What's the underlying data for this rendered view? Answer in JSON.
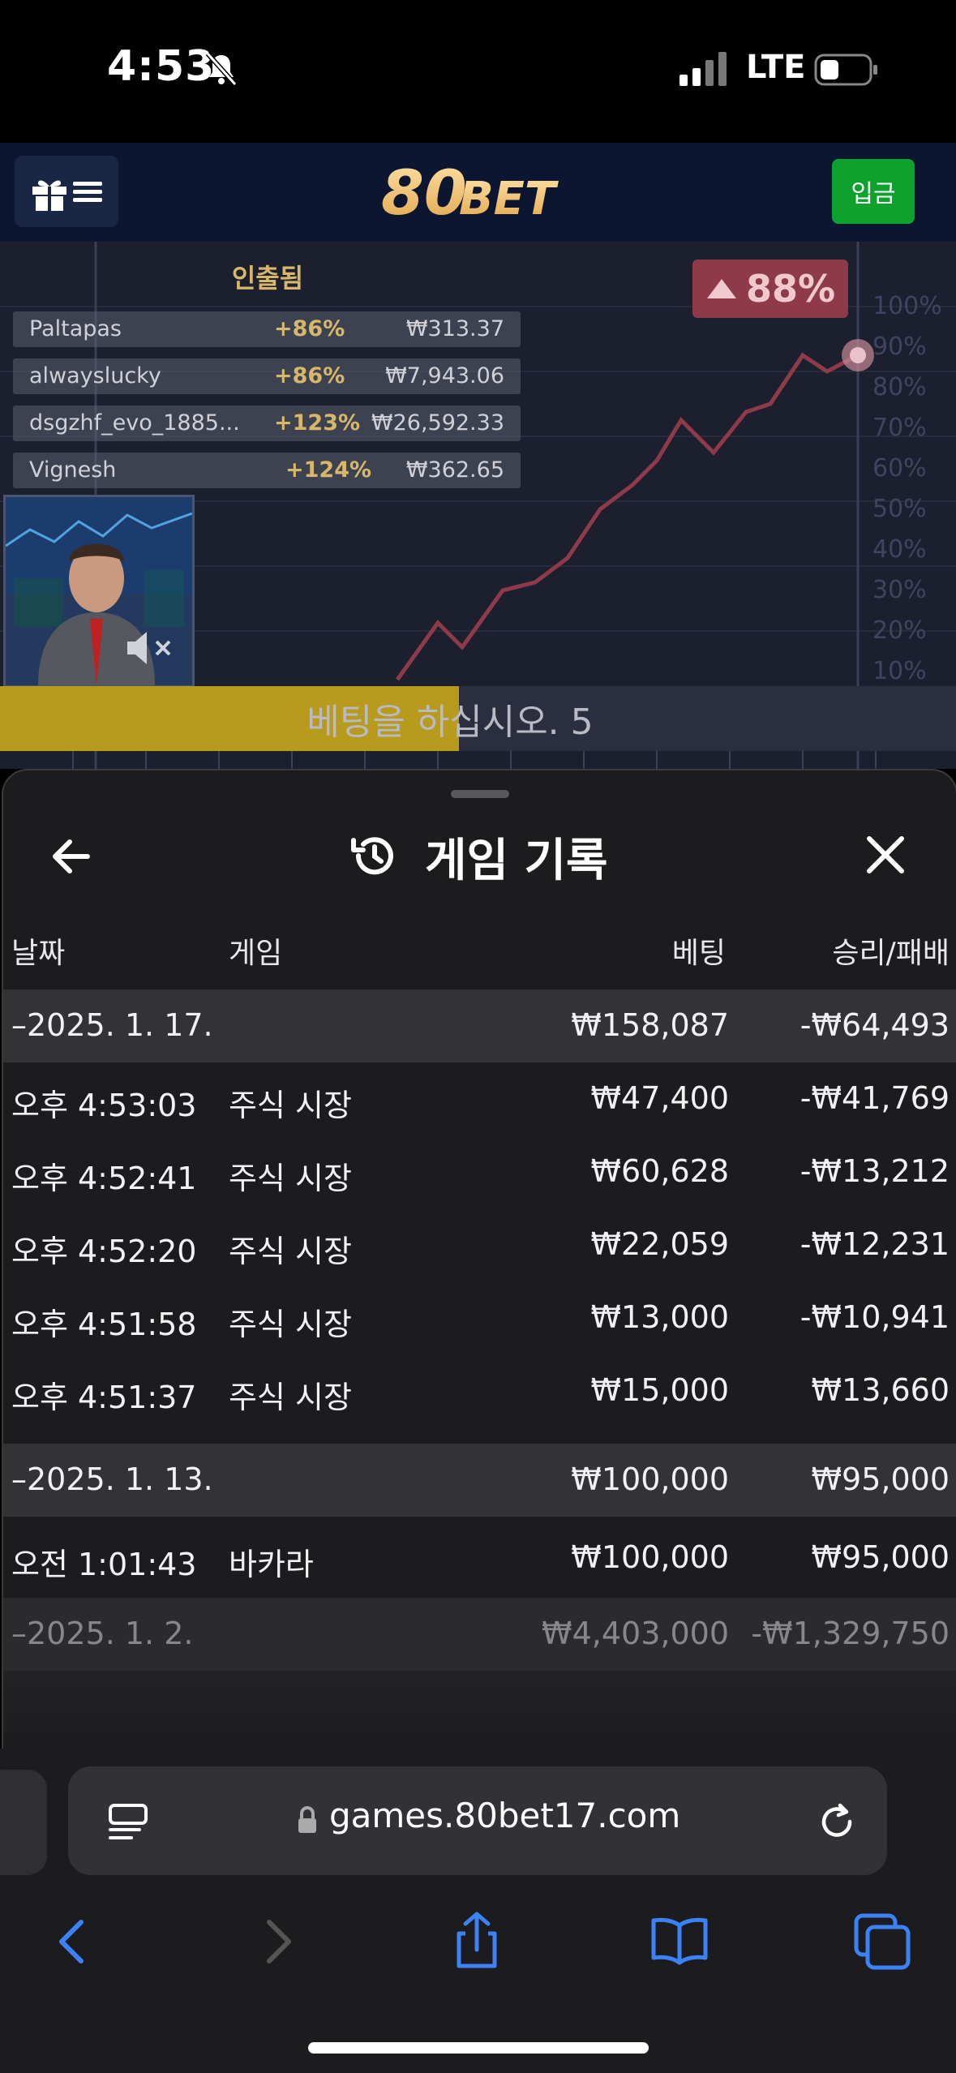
{
  "status_bar": {
    "time": "4:53",
    "network": "LTE"
  },
  "header": {
    "logo": "80BET",
    "deposit_label": "입금"
  },
  "game": {
    "cashed_out_title": "인출됨",
    "winners": [
      {
        "name": "Paltapas",
        "percent": "+86%",
        "amount": "₩313.37"
      },
      {
        "name": "alwayslucky",
        "percent": "+86%",
        "amount": "₩7,943.06"
      },
      {
        "name": "dsgzhf_evo_1885...",
        "percent": "+123%",
        "amount": "₩26,592.33"
      },
      {
        "name": "Vignesh",
        "percent": "+124%",
        "amount": "₩362.65"
      }
    ],
    "current_percent": "88%",
    "axis_labels": [
      "100%",
      "90%",
      "80%",
      "70%",
      "60%",
      "50%",
      "40%",
      "30%",
      "20%",
      "10%"
    ],
    "betting_message": "베팅을 하십시오. 5",
    "betting_progress": 0.48
  },
  "history_sheet": {
    "title": "게임 기록",
    "columns": {
      "date": "날짜",
      "game": "게임",
      "bet": "베팅",
      "win_loss": "승리/패배"
    },
    "groups": [
      {
        "date": "–2025. 1. 17.",
        "bet_total": "₩158,087",
        "result_total": "-₩64,493",
        "rows": [
          {
            "time": "오후 4:53:03",
            "game": "주식 시장",
            "bet": "₩47,400",
            "result": "-₩41,769"
          },
          {
            "time": "오후 4:52:41",
            "game": "주식 시장",
            "bet": "₩60,628",
            "result": "-₩13,212"
          },
          {
            "time": "오후 4:52:20",
            "game": "주식 시장",
            "bet": "₩22,059",
            "result": "-₩12,231"
          },
          {
            "time": "오후 4:51:58",
            "game": "주식 시장",
            "bet": "₩13,000",
            "result": "-₩10,941"
          },
          {
            "time": "오후 4:51:37",
            "game": "주식 시장",
            "bet": "₩15,000",
            "result": "₩13,660"
          }
        ]
      },
      {
        "date": "–2025. 1. 13.",
        "bet_total": "₩100,000",
        "result_total": "₩95,000",
        "rows": [
          {
            "time": "오전 1:01:43",
            "game": "바카라",
            "bet": "₩100,000",
            "result": "₩95,000"
          }
        ]
      },
      {
        "date": "–2025. 1. 2.",
        "bet_total": "₩4,403,000",
        "result_total": "-₩1,329,750",
        "rows": []
      }
    ]
  },
  "browser": {
    "url": "games.80bet17.com"
  },
  "colors": {
    "accent_gold": "#d8b76a",
    "deposit_green": "#0fa12e",
    "safari_blue": "#3b82f6"
  }
}
